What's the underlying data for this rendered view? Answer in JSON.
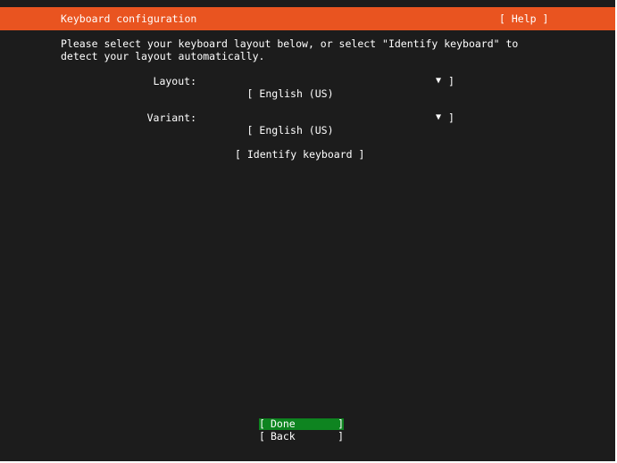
{
  "header": {
    "title": "Keyboard configuration",
    "help_label": "[ Help ]"
  },
  "intro": {
    "text": "Please select your keyboard layout below, or select \"Identify keyboard\" to\ndetect your layout automatically."
  },
  "fields": {
    "layout": {
      "label": "Layout:",
      "open_bracket": "[",
      "value": "English (US)",
      "arrow": "▼",
      "close_bracket": "]"
    },
    "variant": {
      "label": "Variant:",
      "open_bracket": "[",
      "value": "English (US)",
      "arrow": "▼",
      "close_bracket": "]"
    }
  },
  "identify_keyboard": {
    "label": "[ Identify keyboard ]"
  },
  "buttons": {
    "done": {
      "open": "[",
      "label": "Done",
      "close": "]"
    },
    "back": {
      "open": "[",
      "label": "Back",
      "close": "]"
    }
  },
  "colors": {
    "background": "#1c1c1c",
    "header": "#e95420",
    "selected_button": "#0e8420",
    "text": "#ffffff"
  }
}
